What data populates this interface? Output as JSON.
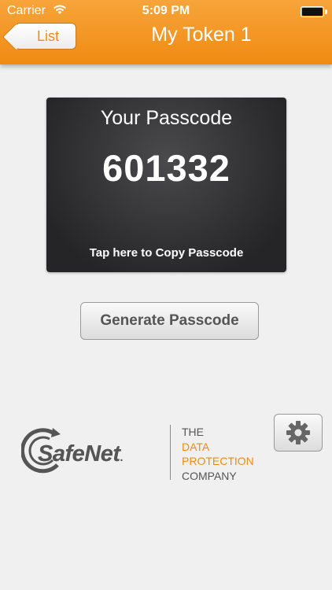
{
  "status_bar": {
    "carrier": "Carrier",
    "time": "5:09 PM"
  },
  "nav": {
    "back_label": "List",
    "title": "My Token 1"
  },
  "passcode_card": {
    "label": "Your Passcode",
    "code": "601332",
    "copy_hint": "Tap here to Copy Passcode"
  },
  "actions": {
    "generate_label": "Generate Passcode"
  },
  "brand": {
    "name": "SafeNet",
    "trademark": ".",
    "tagline": [
      "THE",
      "DATA",
      "PROTECTION",
      "COMPANY"
    ]
  },
  "colors": {
    "accent": "#f08b12",
    "background": "#f0f0f0",
    "card": "#2e2e30"
  },
  "icons": [
    "wifi-icon",
    "battery-icon",
    "back-chevron-icon",
    "gear-icon",
    "safenet-logo-icon"
  ]
}
